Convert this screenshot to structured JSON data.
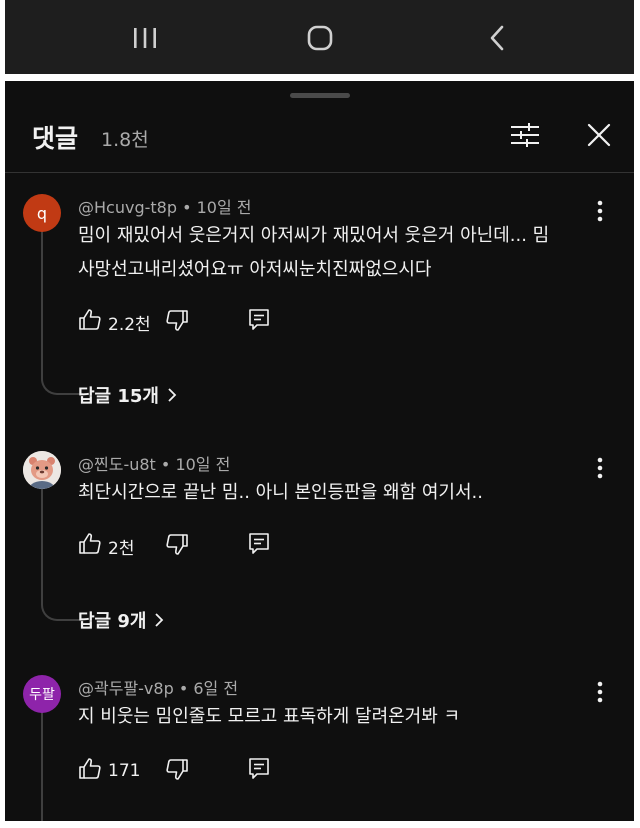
{
  "system_nav": {
    "recents_icon": "recent-apps-icon",
    "home_icon": "home-icon",
    "back_icon": "back-icon"
  },
  "panel": {
    "title": "댓글",
    "count": "1.8천"
  },
  "comments": [
    {
      "avatar_text": "q",
      "avatar_color": "#c13a14",
      "author": "@Hcuvg-t8p",
      "time": "10일 전",
      "text": "밈이 재밌어서 웃은거지 아저씨가 재밌어서 웃은거 아닌데... 밈 사망선고내리셨어요ㅠ 아저씨눈치진짜없으시다",
      "likes": "2.2천",
      "replies": "답글 15개"
    },
    {
      "avatar_text": "",
      "avatar_color": "#e8e3df",
      "author": "@찐도-u8t",
      "time": "10일 전",
      "text": "최단시간으로 끝난 밈.. 아니 본인등판을 왜함 여기서..",
      "likes": "2천",
      "replies": "답글 9개"
    },
    {
      "avatar_text": "두팔",
      "avatar_color": "#8e24aa",
      "author": "@곽두팔-v8p",
      "time": "6일 전",
      "text": "지 비웃는 밈인줄도 모르고 표독하게 달려온거봐 ㅋ",
      "likes": "171",
      "replies": ""
    }
  ]
}
